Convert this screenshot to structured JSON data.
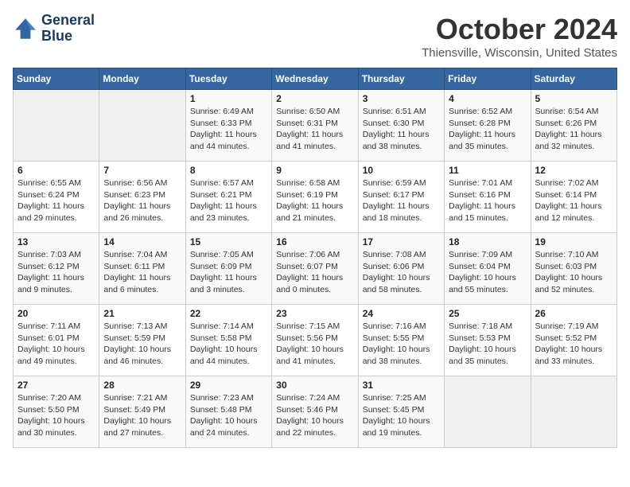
{
  "logo": {
    "line1": "General",
    "line2": "Blue"
  },
  "title": "October 2024",
  "location": "Thiensville, Wisconsin, United States",
  "days_header": [
    "Sunday",
    "Monday",
    "Tuesday",
    "Wednesday",
    "Thursday",
    "Friday",
    "Saturday"
  ],
  "weeks": [
    [
      {
        "num": "",
        "info": ""
      },
      {
        "num": "",
        "info": ""
      },
      {
        "num": "1",
        "info": "Sunrise: 6:49 AM\nSunset: 6:33 PM\nDaylight: 11 hours and 44 minutes."
      },
      {
        "num": "2",
        "info": "Sunrise: 6:50 AM\nSunset: 6:31 PM\nDaylight: 11 hours and 41 minutes."
      },
      {
        "num": "3",
        "info": "Sunrise: 6:51 AM\nSunset: 6:30 PM\nDaylight: 11 hours and 38 minutes."
      },
      {
        "num": "4",
        "info": "Sunrise: 6:52 AM\nSunset: 6:28 PM\nDaylight: 11 hours and 35 minutes."
      },
      {
        "num": "5",
        "info": "Sunrise: 6:54 AM\nSunset: 6:26 PM\nDaylight: 11 hours and 32 minutes."
      }
    ],
    [
      {
        "num": "6",
        "info": "Sunrise: 6:55 AM\nSunset: 6:24 PM\nDaylight: 11 hours and 29 minutes."
      },
      {
        "num": "7",
        "info": "Sunrise: 6:56 AM\nSunset: 6:23 PM\nDaylight: 11 hours and 26 minutes."
      },
      {
        "num": "8",
        "info": "Sunrise: 6:57 AM\nSunset: 6:21 PM\nDaylight: 11 hours and 23 minutes."
      },
      {
        "num": "9",
        "info": "Sunrise: 6:58 AM\nSunset: 6:19 PM\nDaylight: 11 hours and 21 minutes."
      },
      {
        "num": "10",
        "info": "Sunrise: 6:59 AM\nSunset: 6:17 PM\nDaylight: 11 hours and 18 minutes."
      },
      {
        "num": "11",
        "info": "Sunrise: 7:01 AM\nSunset: 6:16 PM\nDaylight: 11 hours and 15 minutes."
      },
      {
        "num": "12",
        "info": "Sunrise: 7:02 AM\nSunset: 6:14 PM\nDaylight: 11 hours and 12 minutes."
      }
    ],
    [
      {
        "num": "13",
        "info": "Sunrise: 7:03 AM\nSunset: 6:12 PM\nDaylight: 11 hours and 9 minutes."
      },
      {
        "num": "14",
        "info": "Sunrise: 7:04 AM\nSunset: 6:11 PM\nDaylight: 11 hours and 6 minutes."
      },
      {
        "num": "15",
        "info": "Sunrise: 7:05 AM\nSunset: 6:09 PM\nDaylight: 11 hours and 3 minutes."
      },
      {
        "num": "16",
        "info": "Sunrise: 7:06 AM\nSunset: 6:07 PM\nDaylight: 11 hours and 0 minutes."
      },
      {
        "num": "17",
        "info": "Sunrise: 7:08 AM\nSunset: 6:06 PM\nDaylight: 10 hours and 58 minutes."
      },
      {
        "num": "18",
        "info": "Sunrise: 7:09 AM\nSunset: 6:04 PM\nDaylight: 10 hours and 55 minutes."
      },
      {
        "num": "19",
        "info": "Sunrise: 7:10 AM\nSunset: 6:03 PM\nDaylight: 10 hours and 52 minutes."
      }
    ],
    [
      {
        "num": "20",
        "info": "Sunrise: 7:11 AM\nSunset: 6:01 PM\nDaylight: 10 hours and 49 minutes."
      },
      {
        "num": "21",
        "info": "Sunrise: 7:13 AM\nSunset: 5:59 PM\nDaylight: 10 hours and 46 minutes."
      },
      {
        "num": "22",
        "info": "Sunrise: 7:14 AM\nSunset: 5:58 PM\nDaylight: 10 hours and 44 minutes."
      },
      {
        "num": "23",
        "info": "Sunrise: 7:15 AM\nSunset: 5:56 PM\nDaylight: 10 hours and 41 minutes."
      },
      {
        "num": "24",
        "info": "Sunrise: 7:16 AM\nSunset: 5:55 PM\nDaylight: 10 hours and 38 minutes."
      },
      {
        "num": "25",
        "info": "Sunrise: 7:18 AM\nSunset: 5:53 PM\nDaylight: 10 hours and 35 minutes."
      },
      {
        "num": "26",
        "info": "Sunrise: 7:19 AM\nSunset: 5:52 PM\nDaylight: 10 hours and 33 minutes."
      }
    ],
    [
      {
        "num": "27",
        "info": "Sunrise: 7:20 AM\nSunset: 5:50 PM\nDaylight: 10 hours and 30 minutes."
      },
      {
        "num": "28",
        "info": "Sunrise: 7:21 AM\nSunset: 5:49 PM\nDaylight: 10 hours and 27 minutes."
      },
      {
        "num": "29",
        "info": "Sunrise: 7:23 AM\nSunset: 5:48 PM\nDaylight: 10 hours and 24 minutes."
      },
      {
        "num": "30",
        "info": "Sunrise: 7:24 AM\nSunset: 5:46 PM\nDaylight: 10 hours and 22 minutes."
      },
      {
        "num": "31",
        "info": "Sunrise: 7:25 AM\nSunset: 5:45 PM\nDaylight: 10 hours and 19 minutes."
      },
      {
        "num": "",
        "info": ""
      },
      {
        "num": "",
        "info": ""
      }
    ]
  ]
}
